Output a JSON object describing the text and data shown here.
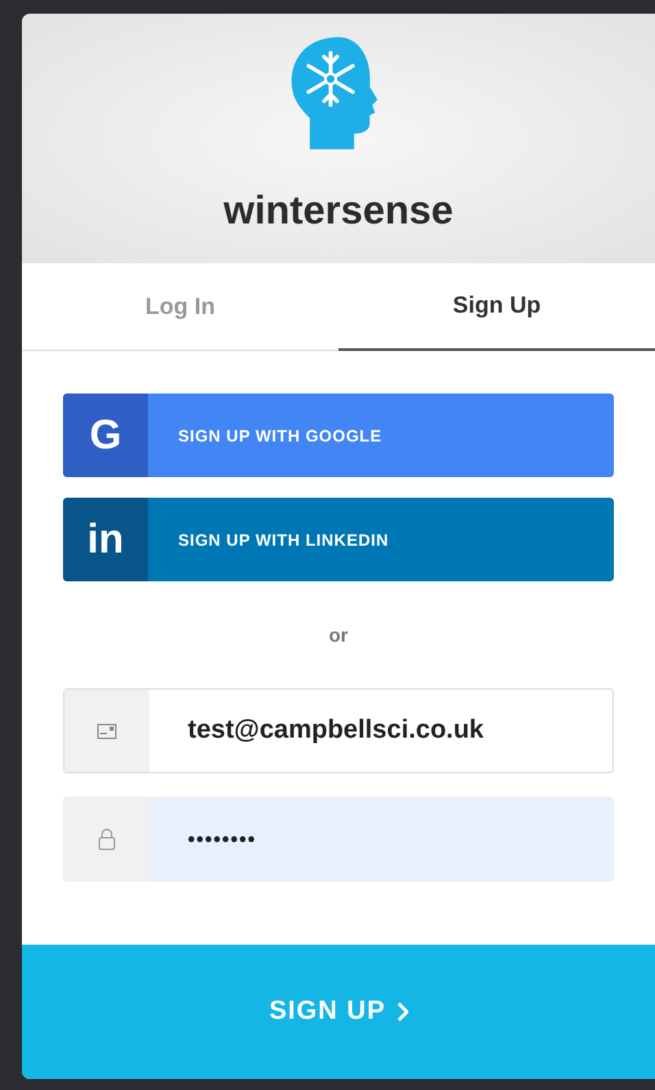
{
  "brand": {
    "name": "wintersense"
  },
  "tabs": [
    {
      "label": "Log In",
      "selected": false
    },
    {
      "label": "Sign Up",
      "selected": true
    }
  ],
  "social_buttons": [
    {
      "kind": "google",
      "logo": "G",
      "label": "SIGN UP WITH GOOGLE"
    },
    {
      "kind": "linkedin",
      "logo": "in",
      "label": "SIGN UP WITH LINKEDIN"
    }
  ],
  "separator": "or",
  "fields": [
    {
      "kind": "email",
      "value": "test@campbellsci.co.uk",
      "autofilled": false
    },
    {
      "kind": "password",
      "value": "••••••••",
      "autofilled": true
    }
  ],
  "submit": {
    "label": "SIGN UP"
  }
}
